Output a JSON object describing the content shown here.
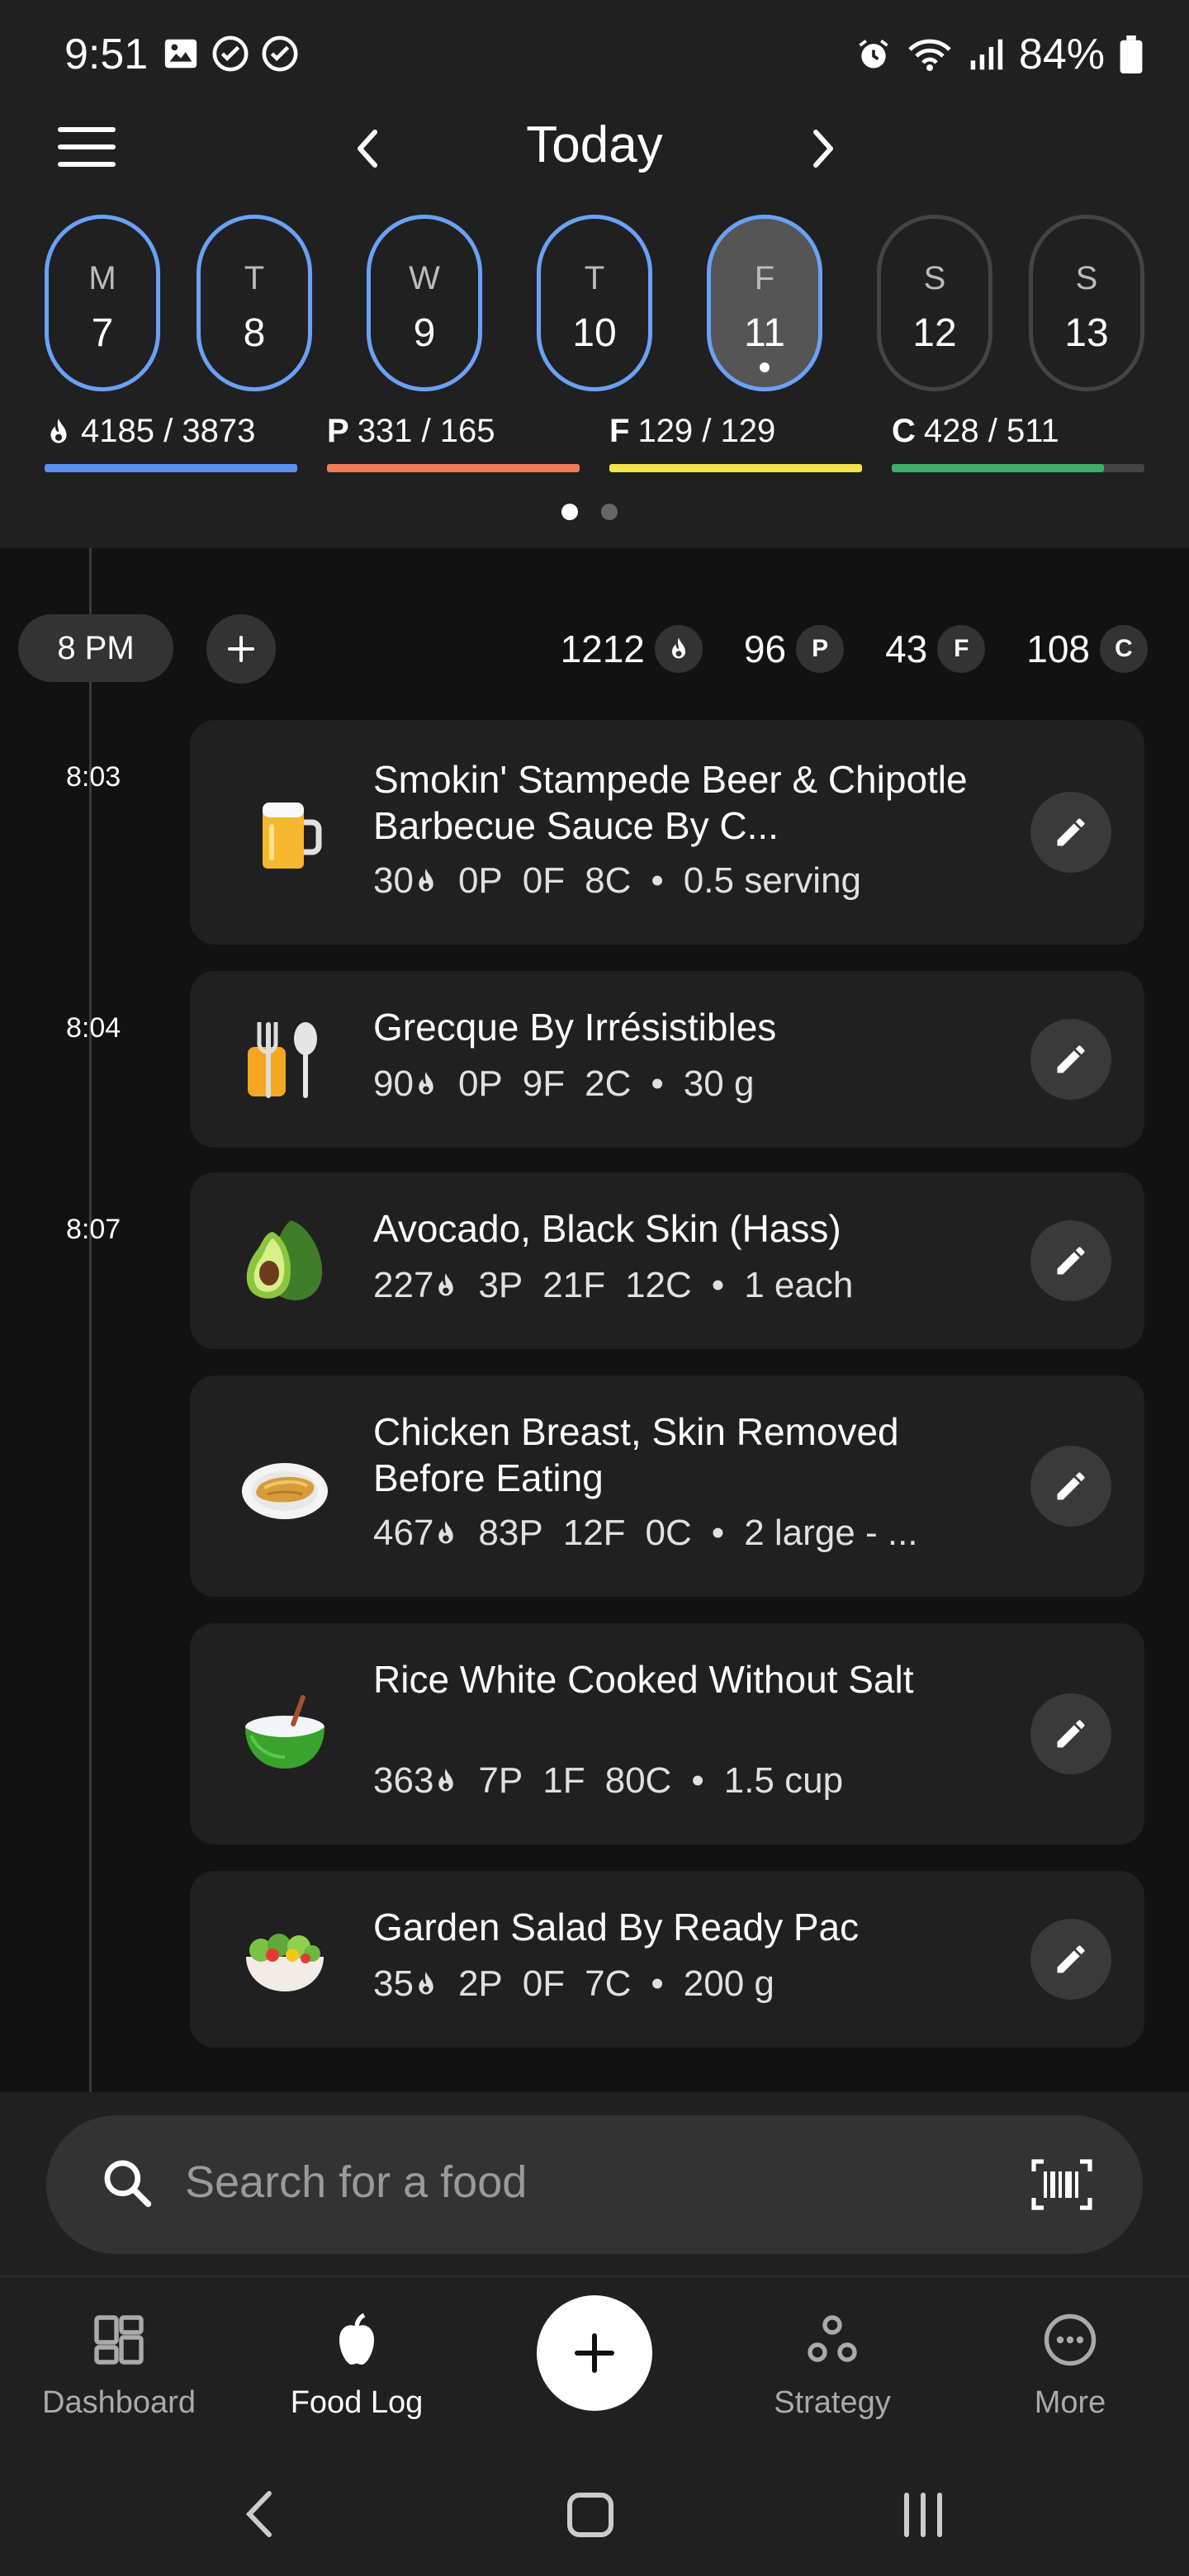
{
  "status_bar": {
    "time": "9:51",
    "battery": "84%"
  },
  "header": {
    "title": "Today"
  },
  "week": [
    {
      "letter": "M",
      "num": "7",
      "state": "past"
    },
    {
      "letter": "T",
      "num": "8",
      "state": "past"
    },
    {
      "letter": "W",
      "num": "9",
      "state": "past"
    },
    {
      "letter": "T",
      "num": "10",
      "state": "past"
    },
    {
      "letter": "F",
      "num": "11",
      "state": "selected"
    },
    {
      "letter": "S",
      "num": "12",
      "state": "future"
    },
    {
      "letter": "S",
      "num": "13",
      "state": "future"
    }
  ],
  "macros": {
    "calories": {
      "label": "4185 / 3873",
      "color": "#5b8ff0",
      "fill": 1.0
    },
    "protein": {
      "prefix": "P",
      "label": "331 / 165",
      "color": "#f07a5b",
      "fill": 1.0
    },
    "fat": {
      "prefix": "F",
      "label": "129 / 129",
      "color": "#f2e34a",
      "fill": 1.0
    },
    "carbs": {
      "prefix": "C",
      "label": "428 / 511",
      "color": "#3fae6a",
      "fill": 0.84
    }
  },
  "meal": {
    "time_label": "8 PM",
    "totals": {
      "calories": "1212",
      "protein": "96",
      "fat": "43",
      "carbs": "108"
    },
    "chips": {
      "protein": "P",
      "fat": "F",
      "carbs": "C"
    }
  },
  "entries": [
    {
      "time": "8:03",
      "name": "Smokin' Stampede Beer & Chipotle Barbecue Sauce By C...",
      "cal": "30",
      "p": "0P",
      "f": "0F",
      "c": "8C",
      "serving": "0.5 serving",
      "icon": "beer-mug-icon"
    },
    {
      "time": "8:04",
      "name": "Grecque By Irrésistibles",
      "cal": "90",
      "p": "0P",
      "f": "9F",
      "c": "2C",
      "serving": "30 g",
      "icon": "fork-knife-icon"
    },
    {
      "time": "8:07",
      "name": "Avocado, Black Skin (Hass)",
      "cal": "227",
      "p": "3P",
      "f": "21F",
      "c": "12C",
      "serving": "1 each",
      "icon": "avocado-icon"
    },
    {
      "time": "",
      "name": "Chicken Breast, Skin Removed Before Eating",
      "cal": "467",
      "p": "83P",
      "f": "12F",
      "c": "0C",
      "serving": "2 large - ...",
      "icon": "chicken-plate-icon"
    },
    {
      "time": "",
      "name": "Rice White Cooked Without Salt",
      "cal": "363",
      "p": "7P",
      "f": "1F",
      "c": "80C",
      "serving": "1.5 cup",
      "icon": "rice-bowl-icon"
    },
    {
      "time": "",
      "name": "Garden Salad By Ready Pac",
      "cal": "35",
      "p": "2P",
      "f": "0F",
      "c": "7C",
      "serving": "200 g",
      "icon": "salad-bowl-icon"
    }
  ],
  "search": {
    "placeholder": "Search for a food"
  },
  "nav": {
    "dashboard": "Dashboard",
    "food_log": "Food Log",
    "strategy": "Strategy",
    "more": "More"
  }
}
